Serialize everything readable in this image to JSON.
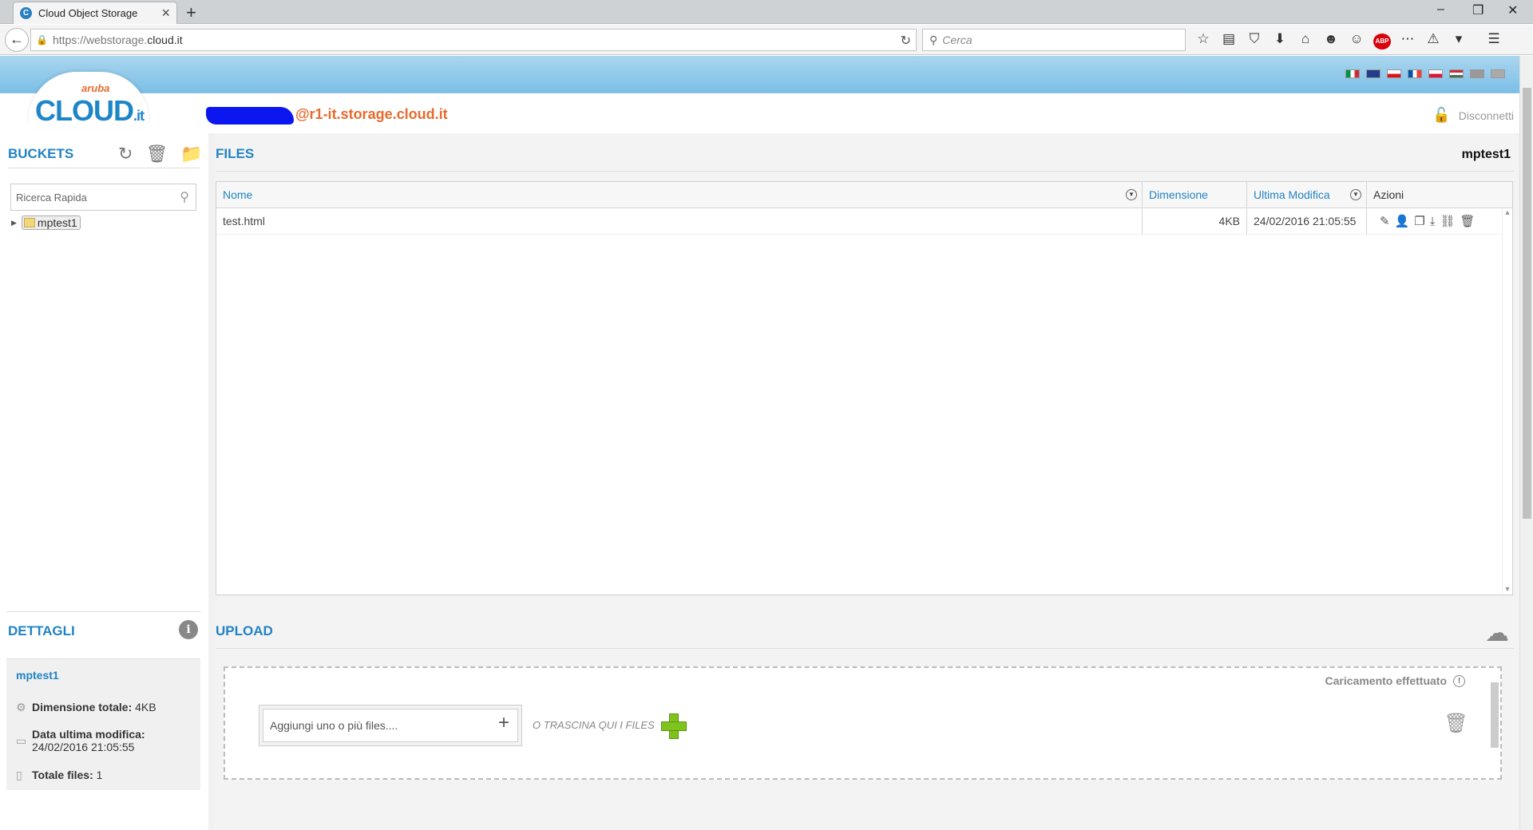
{
  "browser": {
    "tab_title": "Cloud Object Storage",
    "url_scheme": "https://",
    "url_host": "webstorage.",
    "url_domain": "cloud.it",
    "search_placeholder": "Cerca"
  },
  "app": {
    "logo_small": "aruba",
    "logo_big": "CLOUD",
    "logo_suffix": ".it",
    "user_email": "@r1-it.storage.cloud.it",
    "logout_label": "Disconnetti"
  },
  "buckets": {
    "title": "BUCKETS",
    "search_placeholder": "Ricerca Rapida",
    "items": [
      {
        "label": "mptest1"
      }
    ]
  },
  "files": {
    "title": "FILES",
    "current_bucket": "mptest1",
    "columns": [
      "Nome",
      "Dimensione",
      "Ultima Modifica",
      "Azioni"
    ],
    "rows": [
      {
        "name": "test.html",
        "size": "4KB",
        "modified": "24/02/2016 21:05:55"
      }
    ]
  },
  "details": {
    "title": "DETTAGLI",
    "bucket": "mptest1",
    "total_size_label": "Dimensione totale:",
    "total_size": "4KB",
    "last_modified_label": "Data ultima modifica:",
    "last_modified": "24/02/2016 21:05:55",
    "total_files_label": "Totale files:",
    "total_files": "1"
  },
  "upload": {
    "title": "UPLOAD",
    "status": "Caricamento effettuato",
    "add_placeholder": "Aggiungi uno o più files....",
    "drag_text": "O TRASCINA QUI I FILES"
  },
  "colors": {
    "accent": "#2283c3",
    "orange": "#e86a2c",
    "header_blue": "#7cbfe6",
    "green_plus": "#7fc31c"
  }
}
